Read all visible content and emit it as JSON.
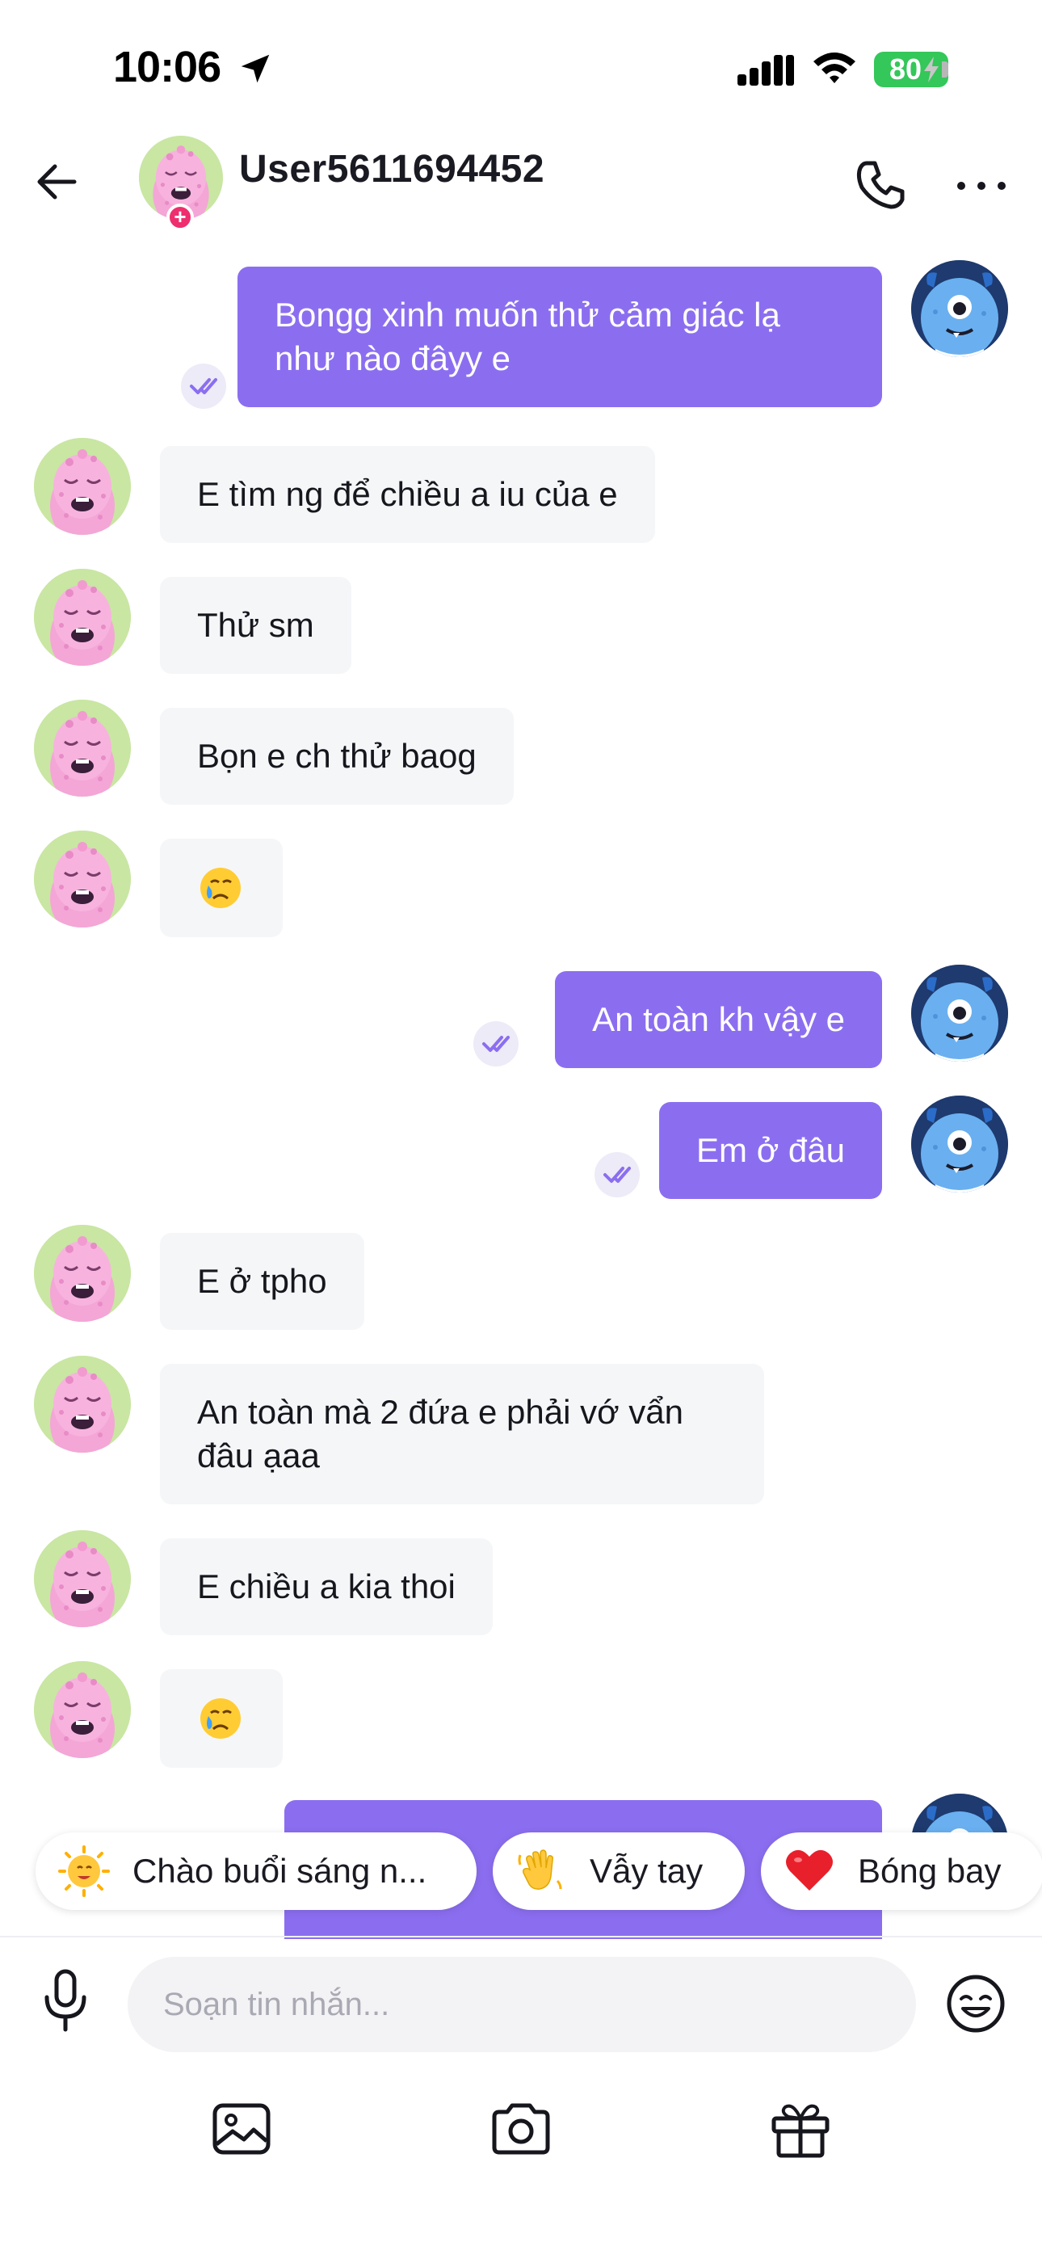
{
  "status_bar": {
    "time": "10:06",
    "battery": "80"
  },
  "header": {
    "contact_name": "User5611694452"
  },
  "messages": [
    {
      "from": "me",
      "text": "Bongg xinh muốn thử cảm giác lạ như nào đâyy e",
      "read": true
    },
    {
      "from": "them",
      "text": "E tìm ng để chiều a iu của e"
    },
    {
      "from": "them",
      "text": "Thử sm"
    },
    {
      "from": "them",
      "text": "Bọn e ch thử baog"
    },
    {
      "from": "them",
      "text": "🥲"
    },
    {
      "from": "me",
      "text": "An toàn kh vậy e",
      "read": true
    },
    {
      "from": "me",
      "text": "Em ở đâu",
      "read": true
    },
    {
      "from": "them",
      "text": "E ở tpho"
    },
    {
      "from": "them",
      "text": "An toàn mà 2 đứa e phải vớ vẩn đâu ạaa"
    },
    {
      "from": "them",
      "text": "E chiều a kia thoi"
    },
    {
      "from": "them",
      "text": "🥲"
    },
    {
      "from": "me",
      "text": "",
      "read": true
    }
  ],
  "quick_replies": [
    {
      "label": "Chào buổi sáng n...",
      "icon": "sun-face-icon"
    },
    {
      "label": "Vẫy tay",
      "icon": "waving-hand-icon"
    },
    {
      "label": "Bóng bay",
      "icon": "red-heart-icon"
    }
  ],
  "composer": {
    "placeholder": "Soạn tin nhắn..."
  },
  "toolbar": {
    "items": [
      "image-icon",
      "camera-icon",
      "gift-icon"
    ]
  },
  "colors": {
    "outgoing_bubble": "#8b6ef0",
    "incoming_bubble": "#f5f6f8",
    "read_check": "#8b6ef0",
    "badge_plus": "#ee2e6e"
  }
}
